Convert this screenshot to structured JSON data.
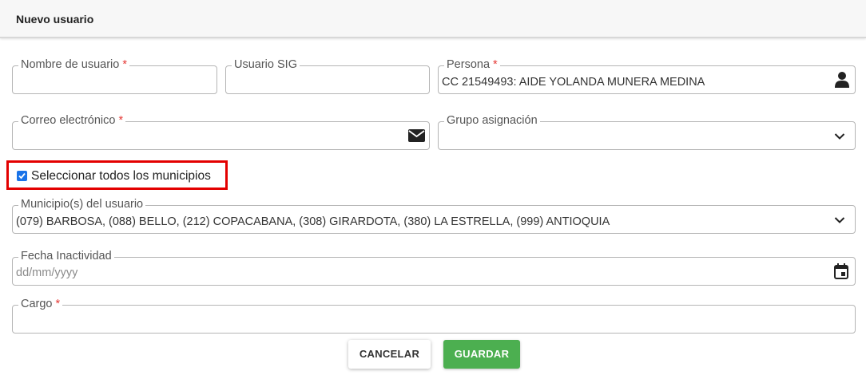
{
  "header": {
    "title": "Nuevo usuario"
  },
  "fields": {
    "username": {
      "label": "Nombre de usuario",
      "required": "*",
      "value": ""
    },
    "usuario_sig": {
      "label": "Usuario SIG",
      "value": ""
    },
    "persona": {
      "label": "Persona",
      "required": "*",
      "value": "CC 21549493: AIDE YOLANDA MUNERA MEDINA",
      "icon": "user-icon"
    },
    "email": {
      "label": "Correo electrónico",
      "required": "*",
      "value": "",
      "icon": "envelope-icon"
    },
    "grupo": {
      "label": "Grupo asignación",
      "value": "",
      "icon": "chevron-down-icon"
    },
    "municipios": {
      "label": "Municipio(s) del usuario",
      "value": "(079) BARBOSA, (088) BELLO, (212) COPACABANA, (308) GIRARDOTA, (380) LA ESTRELLA, (999) ANTIOQUIA",
      "icon": "chevron-down-icon"
    },
    "fecha": {
      "label": "Fecha Inactividad",
      "placeholder": "dd/mm/yyyy",
      "icon": "calendar-icon"
    },
    "cargo": {
      "label": "Cargo",
      "required": "*",
      "value": ""
    }
  },
  "checkbox": {
    "label": "Seleccionar todos los municipios",
    "checked": true,
    "highlight_color": "#e30000"
  },
  "buttons": {
    "cancel": "CANCELAR",
    "save": "GUARDAR"
  },
  "colors": {
    "accent_green": "#4caf50",
    "required_red": "#e53935",
    "checkbox_blue": "#1a73e8"
  }
}
